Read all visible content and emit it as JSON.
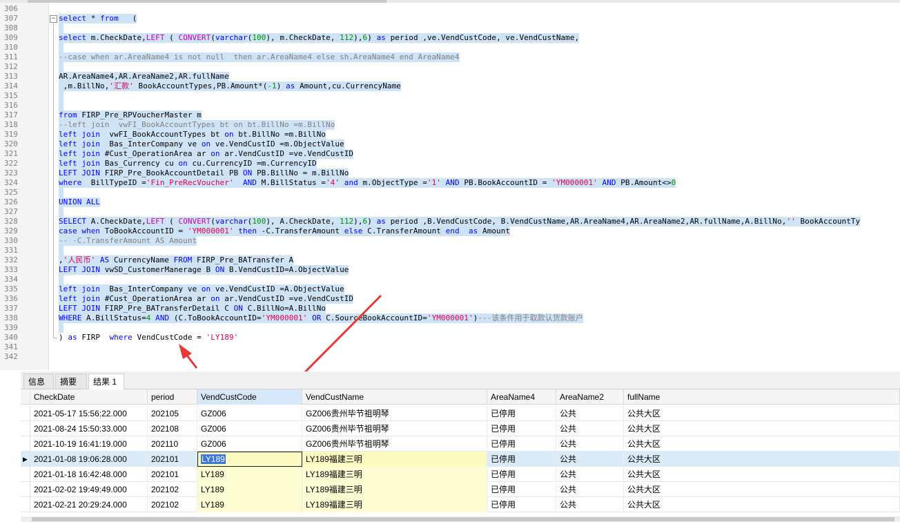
{
  "editor": {
    "lines": [
      {
        "no": "306",
        "hl": false,
        "fold": "",
        "tokens": []
      },
      {
        "no": "307",
        "hl": true,
        "fold": "open",
        "tokens": [
          [
            " select * from   (",
            "kwmix"
          ]
        ]
      },
      {
        "no": "308",
        "hl": true,
        "fold": "",
        "tokens": []
      },
      {
        "no": "309",
        "hl": true,
        "fold": "",
        "tokens": []
      },
      {
        "no": "310",
        "hl": true,
        "fold": "",
        "tokens": []
      },
      {
        "no": "311",
        "hl": true,
        "fold": "",
        "tokens": []
      },
      {
        "no": "312",
        "hl": true,
        "fold": "",
        "tokens": []
      },
      {
        "no": "313",
        "hl": true,
        "fold": "",
        "tokens": []
      },
      {
        "no": "314",
        "hl": true,
        "fold": "",
        "tokens": []
      },
      {
        "no": "315",
        "hl": true,
        "fold": "",
        "tokens": []
      },
      {
        "no": "316",
        "hl": true,
        "fold": "",
        "tokens": []
      },
      {
        "no": "317",
        "hl": true,
        "fold": "",
        "tokens": []
      },
      {
        "no": "318",
        "hl": true,
        "fold": "",
        "tokens": []
      },
      {
        "no": "319",
        "hl": true,
        "fold": "",
        "tokens": []
      },
      {
        "no": "320",
        "hl": true,
        "fold": "",
        "tokens": []
      },
      {
        "no": "321",
        "hl": true,
        "fold": "",
        "tokens": []
      },
      {
        "no": "322",
        "hl": true,
        "fold": "",
        "tokens": []
      },
      {
        "no": "323",
        "hl": true,
        "fold": "",
        "tokens": []
      },
      {
        "no": "324",
        "hl": true,
        "fold": "",
        "tokens": []
      },
      {
        "no": "325",
        "hl": true,
        "fold": "",
        "tokens": []
      },
      {
        "no": "326",
        "hl": true,
        "fold": "",
        "tokens": []
      },
      {
        "no": "327",
        "hl": true,
        "fold": "",
        "tokens": []
      },
      {
        "no": "328",
        "hl": true,
        "fold": "",
        "tokens": []
      },
      {
        "no": "329",
        "hl": true,
        "fold": "",
        "tokens": []
      },
      {
        "no": "330",
        "hl": true,
        "fold": "",
        "tokens": []
      },
      {
        "no": "331",
        "hl": true,
        "fold": "",
        "tokens": []
      },
      {
        "no": "332",
        "hl": true,
        "fold": "",
        "tokens": []
      },
      {
        "no": "333",
        "hl": true,
        "fold": "",
        "tokens": []
      },
      {
        "no": "334",
        "hl": true,
        "fold": "",
        "tokens": []
      },
      {
        "no": "335",
        "hl": true,
        "fold": "",
        "tokens": []
      },
      {
        "no": "336",
        "hl": true,
        "fold": "",
        "tokens": []
      },
      {
        "no": "337",
        "hl": true,
        "fold": "",
        "tokens": []
      },
      {
        "no": "338",
        "hl": true,
        "fold": "",
        "tokens": []
      },
      {
        "no": "339",
        "hl": true,
        "fold": "",
        "tokens": []
      },
      {
        "no": "340",
        "hl": false,
        "fold": "end",
        "tokens": []
      },
      {
        "no": "341",
        "hl": false,
        "fold": "",
        "tokens": []
      },
      {
        "no": "342",
        "hl": false,
        "fold": "",
        "tokens": []
      }
    ],
    "code": {
      "307": [
        [
          "select",
          "kw"
        ],
        [
          " * ",
          ""
        ],
        [
          "from",
          "kw"
        ],
        [
          "   (",
          ""
        ]
      ],
      "308": [],
      "309": [
        [
          "select",
          "kw"
        ],
        [
          " m.CheckDate,",
          ""
        ],
        [
          "LEFT",
          "fn"
        ],
        [
          " ( ",
          ""
        ],
        [
          "CONVERT",
          "fn"
        ],
        [
          "(",
          ""
        ],
        [
          "varchar",
          "kw"
        ],
        [
          "(",
          ""
        ],
        [
          "100",
          "num"
        ],
        [
          "), m.CheckDate, ",
          ""
        ],
        [
          "112",
          "num"
        ],
        [
          "),",
          ""
        ],
        [
          "6",
          "num"
        ],
        [
          ") ",
          ""
        ],
        [
          "as",
          "kw"
        ],
        [
          " period ,ve.VendCustCode, ve.VendCustName,",
          ""
        ]
      ],
      "310": [],
      "311": [
        [
          "--case when ar.AreaName4 is not null  then ar.AreaName4 else sh.AreaName4 end AreaName4",
          "cm"
        ]
      ],
      "312": [],
      "313": [
        [
          "AR.AreaName4,AR.AreaName2,AR.fullName",
          ""
        ]
      ],
      "314": [
        [
          " ,m.BillNo,",
          ""
        ],
        [
          "'汇款'",
          "str"
        ],
        [
          " BookAccountTypes,PB.Amount*(",
          ""
        ],
        [
          "-1",
          "num"
        ],
        [
          ") ",
          ""
        ],
        [
          "as",
          "kw"
        ],
        [
          " Amount,cu.CurrencyName",
          ""
        ]
      ],
      "315": [],
      "316": [],
      "317": [
        [
          "from",
          "kw"
        ],
        [
          " FIRP_Pre_RPVoucherMaster m",
          ""
        ]
      ],
      "318": [
        [
          "--left join  vwFI_BookAccountTypes bt on bt.BillNo =m.BillNo",
          "cm"
        ]
      ],
      "319": [
        [
          "left join",
          "kw"
        ],
        [
          "  vwFI_BookAccountTypes bt ",
          ""
        ],
        [
          "on",
          "kw"
        ],
        [
          " bt.BillNo =m.BillNo",
          ""
        ]
      ],
      "320": [
        [
          "left join",
          "kw"
        ],
        [
          "  Bas_InterCompany ve ",
          ""
        ],
        [
          "on",
          "kw"
        ],
        [
          " ve.VendCustID =m.ObjectValue",
          ""
        ]
      ],
      "321": [
        [
          "left join",
          "kw"
        ],
        [
          " #Cust_OperationArea ar ",
          ""
        ],
        [
          "on",
          "kw"
        ],
        [
          " ar.VendCustID =ve.VendCustID",
          ""
        ]
      ],
      "322": [
        [
          "left join",
          "kw"
        ],
        [
          " Bas_Currency cu ",
          ""
        ],
        [
          "on",
          "kw"
        ],
        [
          " cu.CurrencyID =m.CurrencyID",
          ""
        ]
      ],
      "323": [
        [
          "LEFT JOIN",
          "kw"
        ],
        [
          " FIRP_Pre_BookAccountDetail PB ",
          ""
        ],
        [
          "ON",
          "kw"
        ],
        [
          " PB.BillNo = m.BillNo",
          ""
        ]
      ],
      "324": [
        [
          "where",
          "kw"
        ],
        [
          "  BillTypeID =",
          ""
        ],
        [
          "'Fin_PreRecVoucher'",
          "str"
        ],
        [
          "  ",
          ""
        ],
        [
          "AND",
          "kw"
        ],
        [
          " M.BillStatus =",
          ""
        ],
        [
          "'4'",
          "str"
        ],
        [
          " ",
          ""
        ],
        [
          "and",
          "kw"
        ],
        [
          " m.ObjectType =",
          ""
        ],
        [
          "'1'",
          "str"
        ],
        [
          " ",
          ""
        ],
        [
          "AND",
          "kw"
        ],
        [
          " PB.BookAccountID = ",
          ""
        ],
        [
          "'YM000001'",
          "str"
        ],
        [
          " ",
          ""
        ],
        [
          "AND",
          "kw"
        ],
        [
          " PB.Amount<>",
          ""
        ],
        [
          "0",
          "num"
        ]
      ],
      "325": [],
      "326": [
        [
          "UNION ALL",
          "kw"
        ]
      ],
      "327": [],
      "328": [
        [
          "SELECT",
          "kw"
        ],
        [
          " A.CheckDate,",
          ""
        ],
        [
          "LEFT",
          "fn"
        ],
        [
          " ( ",
          ""
        ],
        [
          "CONVERT",
          "fn"
        ],
        [
          "(",
          ""
        ],
        [
          "varchar",
          "kw"
        ],
        [
          "(",
          ""
        ],
        [
          "100",
          "num"
        ],
        [
          "), A.CheckDate, ",
          ""
        ],
        [
          "112",
          "num"
        ],
        [
          "),",
          ""
        ],
        [
          "6",
          "num"
        ],
        [
          ") ",
          ""
        ],
        [
          "as",
          "kw"
        ],
        [
          " period ,B.VendCustCode, B.VendCustName,AR.AreaName4,AR.AreaName2,AR.fullName,A.BillNo,",
          ""
        ],
        [
          "''",
          "str"
        ],
        [
          " BookAccountTy",
          ""
        ]
      ],
      "329": [
        [
          "case",
          "kw"
        ],
        [
          " ",
          ""
        ],
        [
          "when",
          "kw"
        ],
        [
          " ToBookAccountID = ",
          ""
        ],
        [
          "'YM000001'",
          "str"
        ],
        [
          " ",
          ""
        ],
        [
          "then",
          "kw"
        ],
        [
          " -C.TransferAmount ",
          ""
        ],
        [
          "else",
          "kw"
        ],
        [
          " C.TransferAmount ",
          ""
        ],
        [
          "end",
          "kw"
        ],
        [
          "  ",
          ""
        ],
        [
          "as",
          "kw"
        ],
        [
          " Amount",
          ""
        ]
      ],
      "330": [
        [
          "-- -C.TransferAmount AS Amount",
          "cm"
        ]
      ],
      "331": [],
      "332": [
        [
          ",",
          ""
        ],
        [
          "'人民币'",
          "str"
        ],
        [
          " ",
          ""
        ],
        [
          "AS",
          "kw"
        ],
        [
          " CurrencyName ",
          ""
        ],
        [
          "FROM",
          "kw"
        ],
        [
          " FIRP_Pre_BATransfer A",
          ""
        ]
      ],
      "333": [
        [
          "LEFT JOIN",
          "kw"
        ],
        [
          " vwSD_CustomerManerage B ",
          ""
        ],
        [
          "ON",
          "kw"
        ],
        [
          " B.VendCustID=A.ObjectValue",
          ""
        ]
      ],
      "334": [],
      "335": [
        [
          "left join",
          "kw"
        ],
        [
          "  Bas_InterCompany ve ",
          ""
        ],
        [
          "on",
          "kw"
        ],
        [
          " ve.VendCustID =A.ObjectValue",
          ""
        ]
      ],
      "336": [
        [
          "left join",
          "kw"
        ],
        [
          " #Cust_OperationArea ar ",
          ""
        ],
        [
          "on",
          "kw"
        ],
        [
          " ar.VendCustID =ve.VendCustID",
          ""
        ]
      ],
      "337": [
        [
          "LEFT JOIN",
          "kw"
        ],
        [
          " FIRP_Pre_BATransferDetail C ",
          ""
        ],
        [
          "ON",
          "kw"
        ],
        [
          " C.BillNo=A.BillNo",
          ""
        ]
      ],
      "338": [
        [
          "WHERE",
          "kw"
        ],
        [
          " A.BillStatus=",
          ""
        ],
        [
          "4",
          "num"
        ],
        [
          " ",
          ""
        ],
        [
          "AND",
          "kw"
        ],
        [
          " (C.ToBookAccountID=",
          ""
        ],
        [
          "'YM000001'",
          "str"
        ],
        [
          " ",
          ""
        ],
        [
          "OR",
          "kw"
        ],
        [
          " C.SourceBookAccountID=",
          ""
        ],
        [
          "'YM000001'",
          "str"
        ],
        [
          ")",
          ""
        ],
        [
          "---该条件用于取款认货款账户",
          "cm"
        ]
      ],
      "339": [],
      "340": [
        [
          ") ",
          ""
        ],
        [
          "as",
          "kw"
        ],
        [
          " FIRP  ",
          ""
        ],
        [
          "where",
          "kw"
        ],
        [
          " VendCustCode = ",
          ""
        ],
        [
          "'LY189'",
          "str"
        ]
      ],
      "341": [],
      "342": []
    }
  },
  "tabs": [
    {
      "label": "信息",
      "active": false
    },
    {
      "label": "摘要",
      "active": false
    },
    {
      "label": "结果 1",
      "active": true
    }
  ],
  "grid": {
    "columns": [
      "CheckDate",
      "period",
      "VendCustCode",
      "VendCustName",
      "AreaName4",
      "AreaName2",
      "fullName"
    ],
    "sorted_column": "VendCustCode",
    "current_row_marker": "▶",
    "rows": [
      [
        "2021-05-17 15:56:22.000",
        "202105",
        "GZ006",
        "GZ006贵州毕节祖明琴",
        "已停用",
        "公共",
        "公共大区"
      ],
      [
        "2021-08-24 15:50:33.000",
        "202108",
        "GZ006",
        "GZ006贵州毕节祖明琴",
        "已停用",
        "公共",
        "公共大区"
      ],
      [
        "2021-10-19 16:41:19.000",
        "202110",
        "GZ006",
        "GZ006贵州毕节祖明琴",
        "已停用",
        "公共",
        "公共大区"
      ],
      [
        "2021-01-08 19:06:28.000",
        "202101",
        "LY189",
        "LY189福建三明",
        "已停用",
        "公共",
        "公共大区"
      ],
      [
        "2021-01-18 16:42:48.000",
        "202101",
        "LY189",
        "LY189福建三明",
        "已停用",
        "公共",
        "公共大区"
      ],
      [
        "2021-02-02 19:49:49.000",
        "202102",
        "LY189",
        "LY189福建三明",
        "已停用",
        "公共",
        "公共大区"
      ],
      [
        "2021-02-21 20:29:24.000",
        "202102",
        "LY189",
        "LY189福建三明",
        "已停用",
        "公共",
        "公共大区"
      ]
    ],
    "selected_row": 3,
    "colors": {
      "selection": "#cfe3f7",
      "selected_row": "#dcebfa",
      "arrow": "#e53935"
    }
  }
}
